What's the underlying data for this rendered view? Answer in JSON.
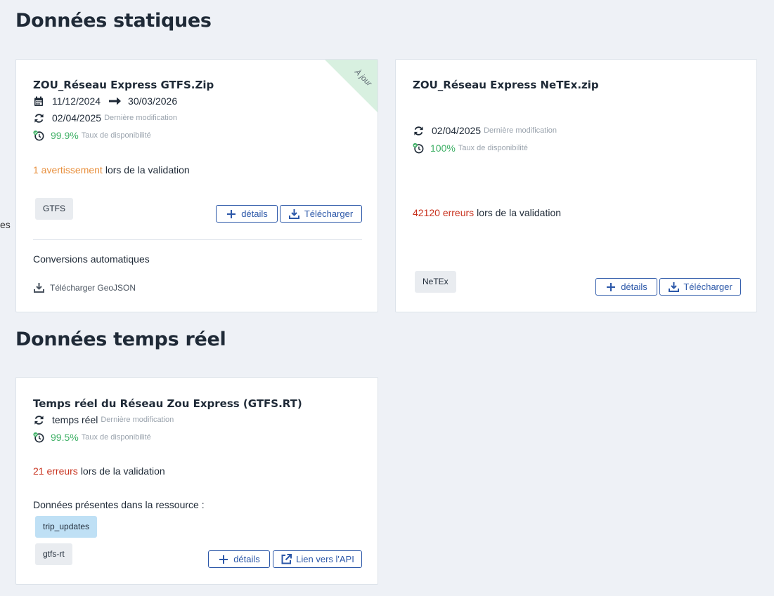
{
  "sections": {
    "static_title": "Données statiques",
    "realtime_title": "Données temps réel",
    "edge_fragment": "es"
  },
  "gtfs_card": {
    "title": "ZOU_Réseau Express GTFS.Zip",
    "ribbon": "À jour",
    "date_start": "11/12/2024",
    "date_end": "30/03/2026",
    "modified_date": "02/04/2025",
    "modified_label": "Dernière modification",
    "availability": "99.9%",
    "availability_label": "Taux de disponibilité",
    "validation_count": "1 avertissement",
    "validation_suffix": "lors de la validation",
    "tag": "GTFS",
    "details_label": "détails",
    "download_label": "Télécharger",
    "conversions_title": "Conversions automatiques",
    "geojson_label": "Télécharger GeoJSON"
  },
  "netex_card": {
    "title": "ZOU_Réseau Express NeTEx.zip",
    "modified_date": "02/04/2025",
    "modified_label": "Dernière modification",
    "availability": "100%",
    "availability_label": "Taux de disponibilité",
    "validation_count": "42120 erreurs",
    "validation_suffix": "lors de la validation",
    "tag": "NeTEx",
    "details_label": "détails",
    "download_label": "Télécharger"
  },
  "rt_card": {
    "title": "Temps réel du Réseau Zou Express (GTFS.RT)",
    "modified_value": "temps réel",
    "modified_label": "Dernière modification",
    "availability": "99.5%",
    "availability_label": "Taux de disponibilité",
    "validation_count": "21 erreurs",
    "validation_suffix": "lors de la validation",
    "resource_label": "Données présentes dans la ressource :",
    "feature_tag": "trip_updates",
    "tag": "gtfs-rt",
    "details_label": "détails",
    "api_label": "Lien vers l'API"
  },
  "colors": {
    "background": "#eef1f6",
    "accent_blue": "#2b57a8",
    "ok_green": "#3fb066",
    "warning_orange": "#e8903e",
    "error_red": "#c8321e",
    "ribbon_green": "#d8f0e0"
  }
}
